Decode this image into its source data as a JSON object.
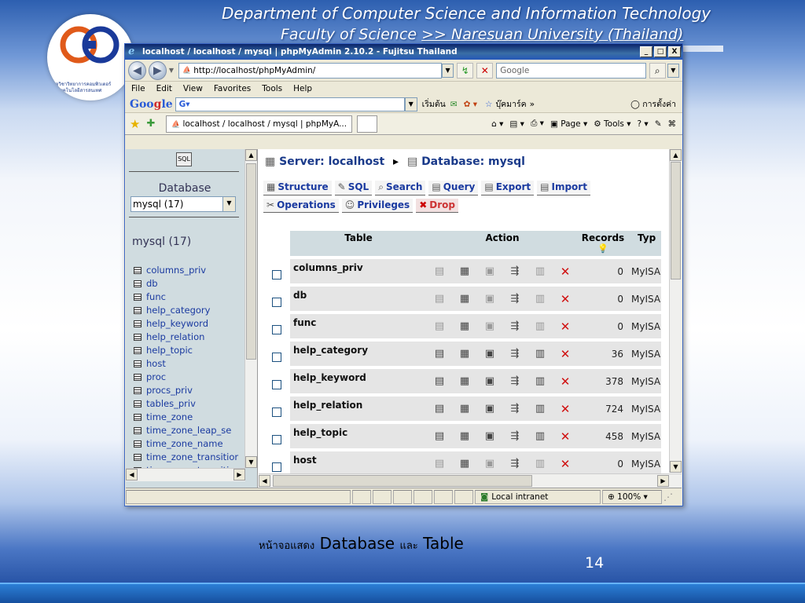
{
  "slide": {
    "header_line1": "Department of Computer Science and Information Technology",
    "header_line2_prefix": "Faculty of Science",
    "header_line2_link": ">> Naresuan University (Thailand)",
    "logo_text_line1": "ภาควิชาวิทยาการคอมพิวเตอร์",
    "logo_text_line2": "และเทคโนโลยีสารสนเทศ",
    "caption_thai_prefix": "หน้าจอแสดง",
    "caption_word1": "Database",
    "caption_thai_mid": "และ",
    "caption_word2": "Table",
    "page_number": "14"
  },
  "browser": {
    "title": "localhost / localhost / mysql | phpMyAdmin 2.10.2 - Fujitsu Thailand",
    "window_buttons": [
      "_",
      "□",
      "X"
    ],
    "address": "http://localhost/phpMyAdmin/",
    "search_placeholder": "Google",
    "menu": [
      "File",
      "Edit",
      "View",
      "Favorites",
      "Tools",
      "Help"
    ],
    "google_label_start": "เริ่มต้น",
    "google_label_bookmarks": "บุ๊คมาร์ค",
    "google_label_settings": "การตั้งค่า",
    "tab_label": "localhost / localhost / mysql | phpMyA...",
    "cmd_page": "Page",
    "cmd_tools": "Tools",
    "status_zone": "Local intranet",
    "zoom": "100%"
  },
  "sidebar": {
    "db_label": "Database",
    "db_select": "mysql (17)",
    "db_name": "mysql (17)",
    "tables": [
      "columns_priv",
      "db",
      "func",
      "help_category",
      "help_keyword",
      "help_relation",
      "help_topic",
      "host",
      "proc",
      "procs_priv",
      "tables_priv",
      "time_zone",
      "time_zone_leap_se",
      "time_zone_name",
      "time_zone_transitior",
      "time_zone_transitior"
    ]
  },
  "main": {
    "server_label": "Server: localhost",
    "database_label": "Database: mysql",
    "tabs_row1": [
      "Structure",
      "SQL",
      "Search",
      "Query",
      "Export",
      "Import"
    ],
    "tabs_row2": [
      "Operations",
      "Privileges",
      "Drop"
    ],
    "headers": {
      "table": "Table",
      "action": "Action",
      "records": "Records",
      "type": "Typ"
    },
    "rows": [
      {
        "name": "columns_priv",
        "records": "0",
        "type": "MyISA"
      },
      {
        "name": "db",
        "records": "0",
        "type": "MyISA"
      },
      {
        "name": "func",
        "records": "0",
        "type": "MyISA"
      },
      {
        "name": "help_category",
        "records": "36",
        "type": "MyISA"
      },
      {
        "name": "help_keyword",
        "records": "378",
        "type": "MyISA"
      },
      {
        "name": "help_relation",
        "records": "724",
        "type": "MyISA"
      },
      {
        "name": "help_topic",
        "records": "458",
        "type": "MyISA"
      },
      {
        "name": "host",
        "records": "0",
        "type": "MyISA"
      }
    ]
  }
}
